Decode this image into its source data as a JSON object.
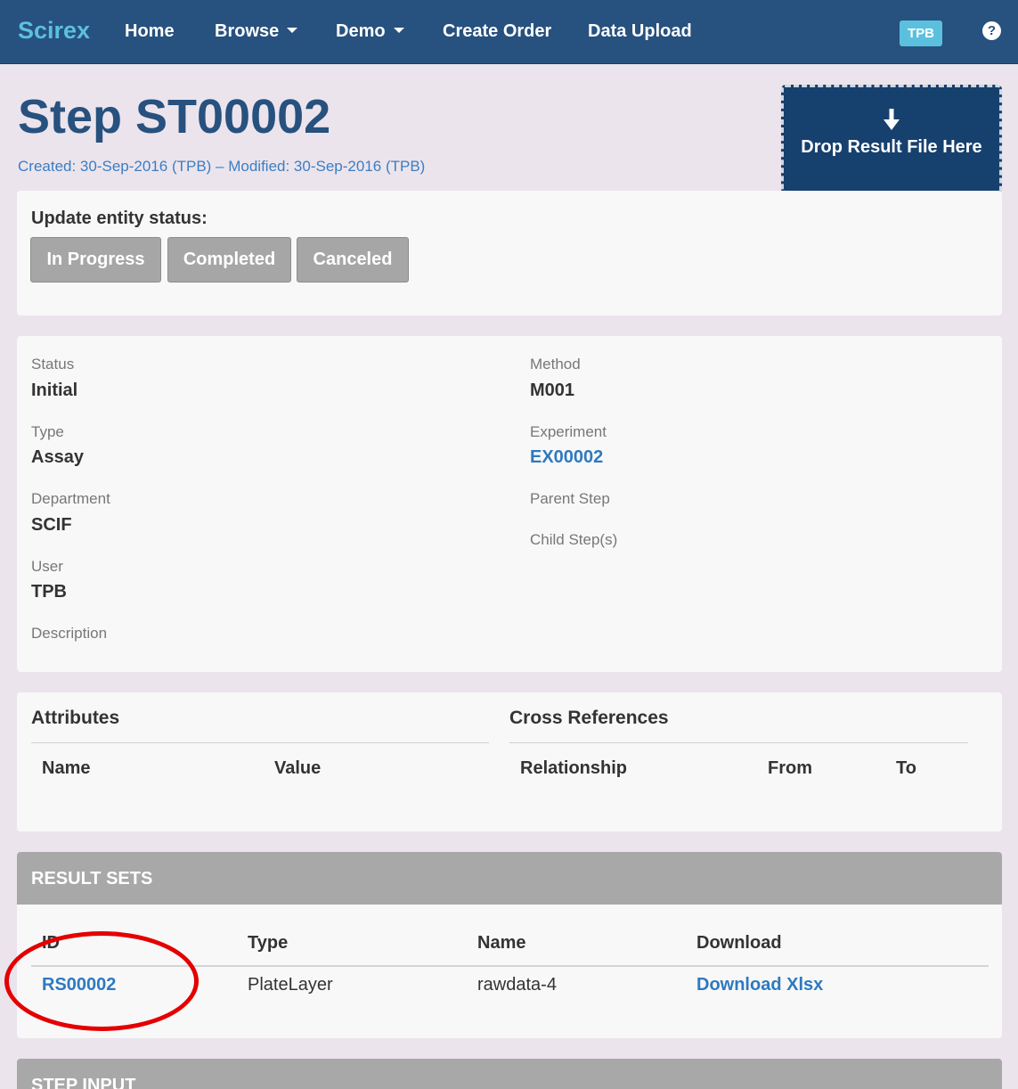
{
  "navbar": {
    "brand": "Scirex",
    "items": [
      {
        "label": "Home",
        "dropdown": false
      },
      {
        "label": "Browse",
        "dropdown": true
      },
      {
        "label": "Demo",
        "dropdown": true
      },
      {
        "label": "Create Order",
        "dropdown": false
      },
      {
        "label": "Data Upload",
        "dropdown": false
      }
    ],
    "user_badge": "TPB",
    "help_icon": "question-circle-icon"
  },
  "header": {
    "title": "Step ST00002",
    "meta": "Created: 30-Sep-2016 (TPB) – Modified: 30-Sep-2016 (TPB)"
  },
  "drop_zone": {
    "icon": "arrow-down-icon",
    "label": "Drop Result File Here"
  },
  "status_update": {
    "title": "Update entity status:",
    "buttons": [
      "In Progress",
      "Completed",
      "Canceled"
    ]
  },
  "details": {
    "left": [
      {
        "label": "Status",
        "value": "Initial"
      },
      {
        "label": "Type",
        "value": "Assay"
      },
      {
        "label": "Department",
        "value": "SCIF"
      },
      {
        "label": "User",
        "value": "TPB"
      },
      {
        "label": "Description",
        "value": ""
      }
    ],
    "right": [
      {
        "label": "Method",
        "value": "M001"
      },
      {
        "label": "Experiment",
        "value": "EX00002"
      },
      {
        "label": "Parent Step",
        "value": ""
      },
      {
        "label": "Child Step(s)",
        "value": ""
      }
    ]
  },
  "attributes": {
    "title": "Attributes",
    "columns": [
      "Name",
      "Value"
    ]
  },
  "cross_references": {
    "title": "Cross References",
    "columns": [
      "Relationship",
      "From",
      "To"
    ]
  },
  "result_sets": {
    "title": "RESULT SETS",
    "columns": [
      "ID",
      "Type",
      "Name",
      "Download"
    ],
    "rows": [
      {
        "id": "RS00002",
        "type": "PlateLayer",
        "name": "rawdata-4",
        "download": "Download Xlsx"
      }
    ]
  },
  "step_input": {
    "title": "STEP INPUT"
  },
  "colors": {
    "navbar": "#27517e",
    "brand": "#5bc0de",
    "link": "#2f79c0",
    "annotation": "#e40000"
  }
}
